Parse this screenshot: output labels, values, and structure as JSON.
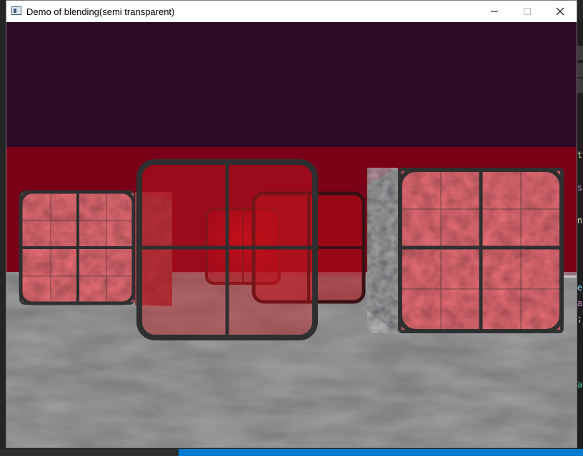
{
  "window": {
    "title": "Demo of blending(semi transparent)",
    "icon": "app-window-icon",
    "controls": {
      "minimize": "minimize-icon",
      "maximize": "maximize-icon",
      "close": "close-icon"
    }
  },
  "scene": {
    "clear_color": "#2e0b24",
    "floor_color": "#5b5d5e",
    "wall_color": "#7a0017",
    "box_texture_color": "#7e2226",
    "window_frame_color": "#2f2f2f",
    "glass_color": "#d0101a"
  },
  "background_editor": {
    "edge_glyphs": [
      "t",
      "s",
      "n",
      "e",
      "a",
      ";",
      "a"
    ]
  }
}
